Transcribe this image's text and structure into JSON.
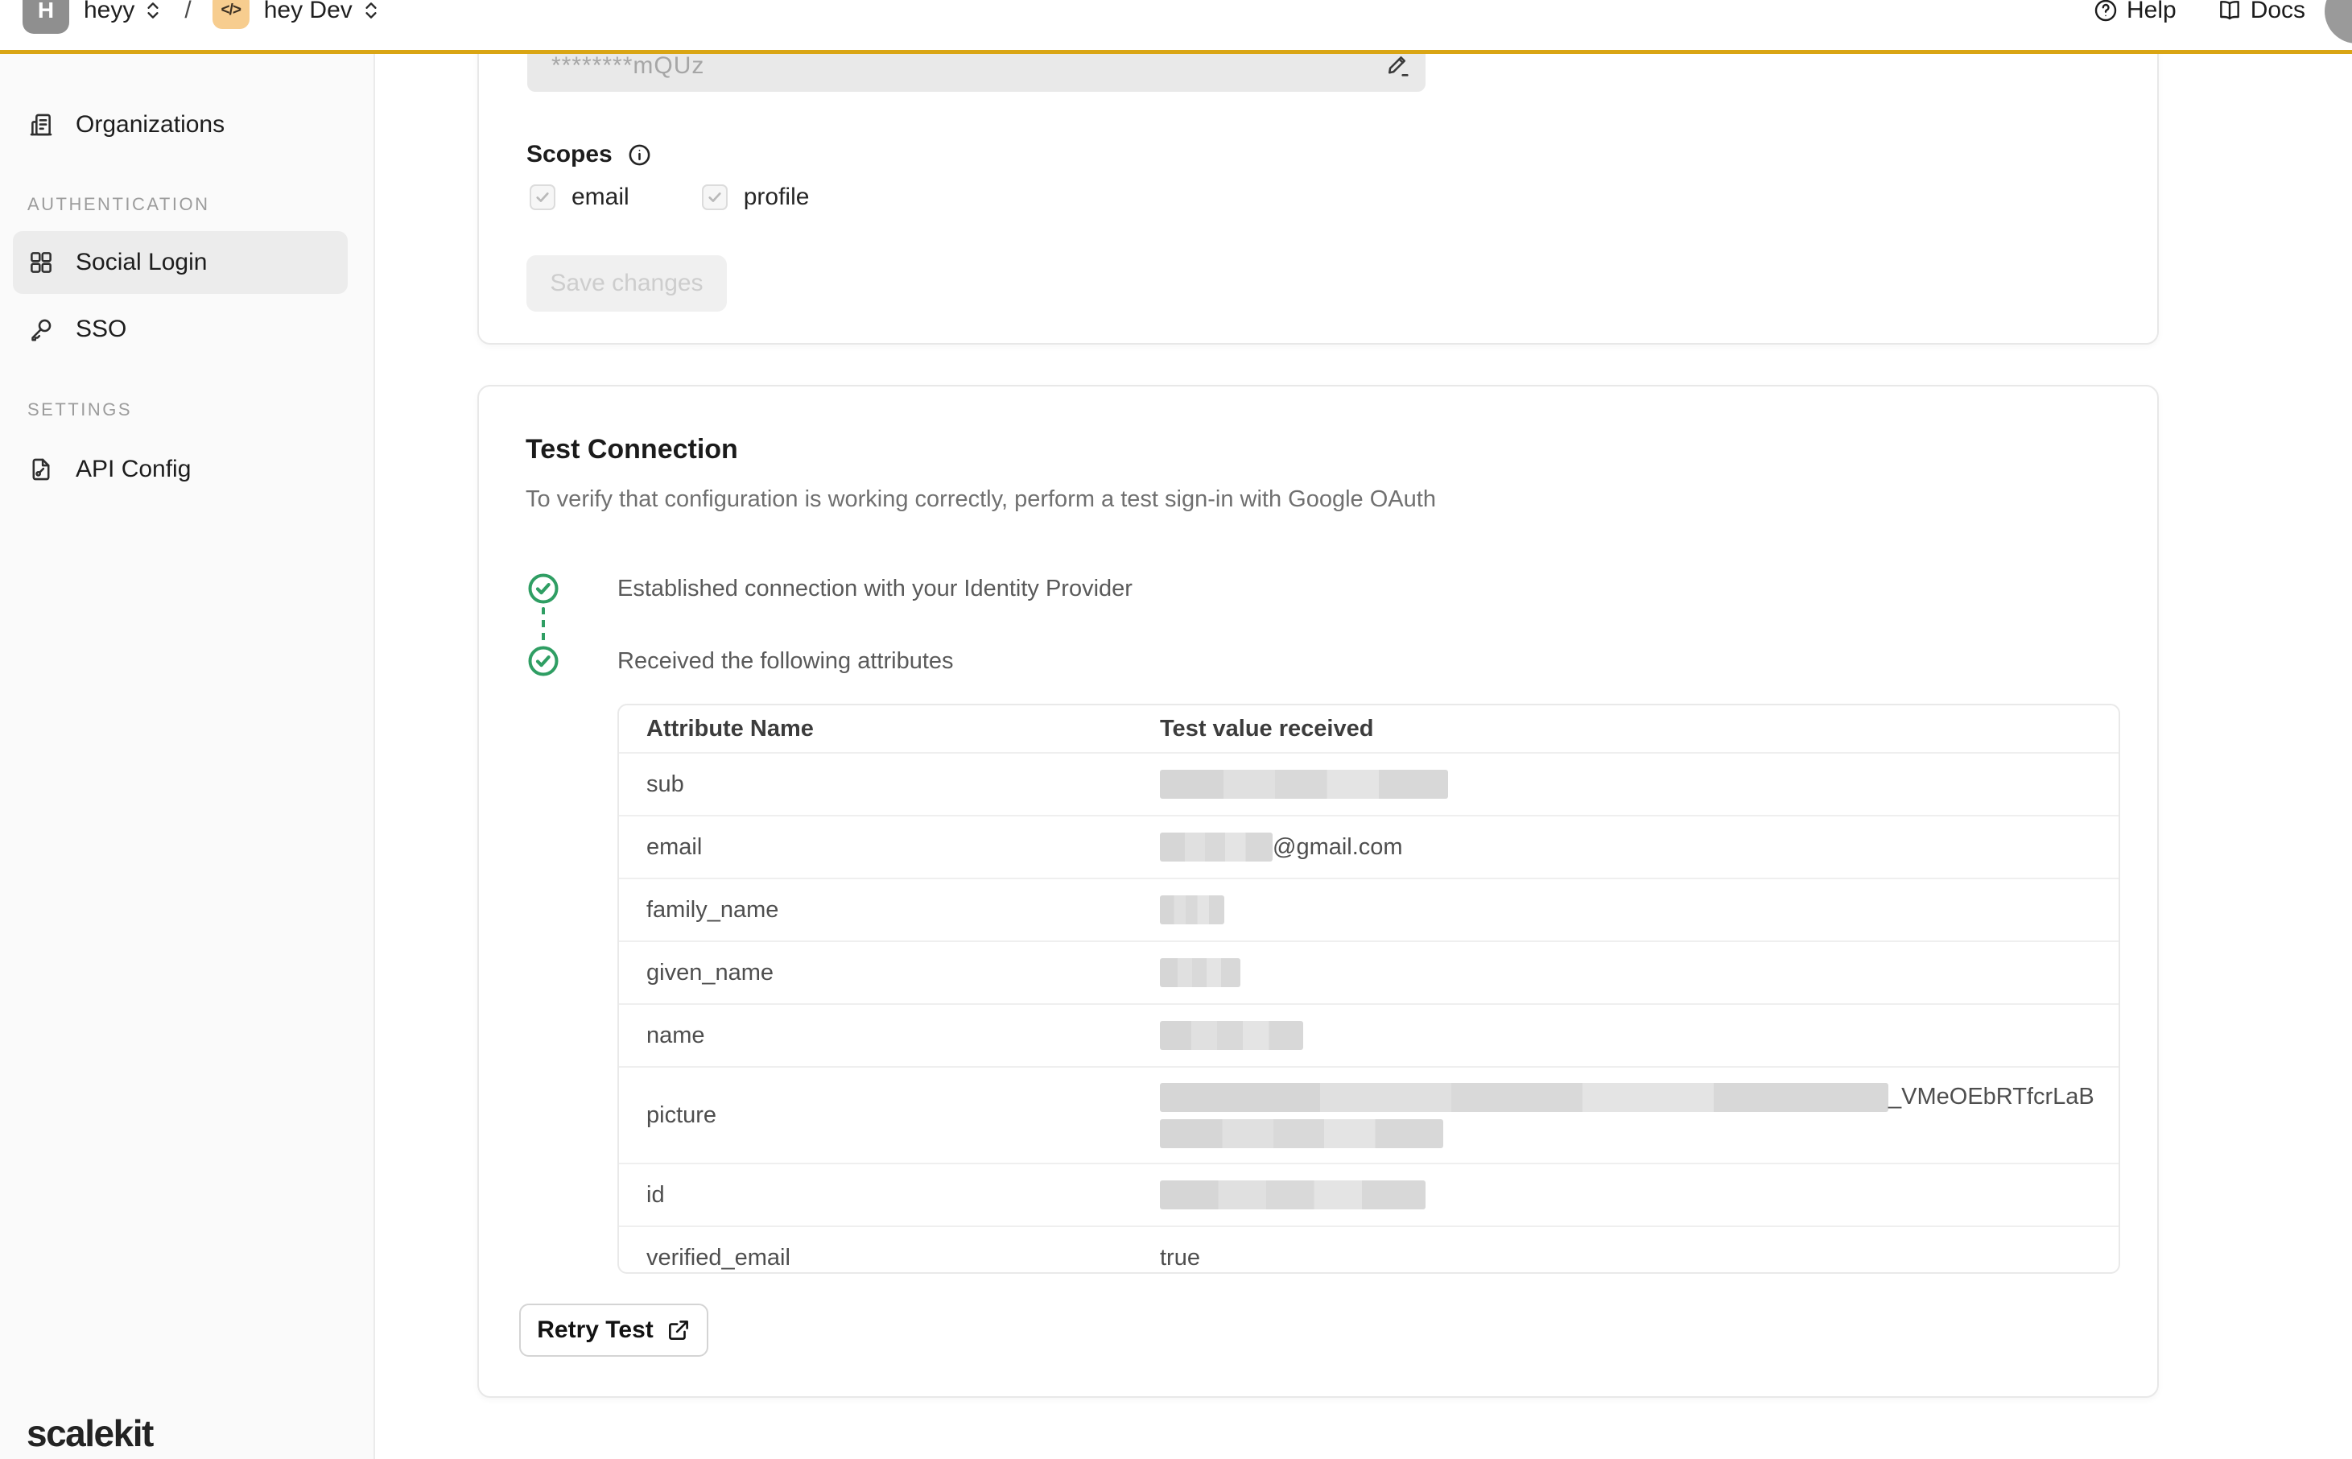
{
  "colors": {
    "accent_gold": "#D9A514",
    "success_green": "#2F9E63",
    "redaction_gray": "#d9d9d9",
    "sidebar_bg": "#fafafa",
    "active_item_bg": "#ececec",
    "project_icon_bg": "#F7CD8F",
    "disabled_button_bg": "#f0f0f0"
  },
  "topbar": {
    "org_initial": "H",
    "org_name": "heyy",
    "separator": "/",
    "project_glyph": "</>",
    "project_name": "hey Dev",
    "help_label": "Help",
    "docs_label": "Docs"
  },
  "sidebar": {
    "sections": [
      {
        "label": "",
        "items": [
          {
            "label": "Organizations",
            "icon": "building-icon",
            "active": false
          }
        ]
      },
      {
        "label": "AUTHENTICATION",
        "items": [
          {
            "label": "Social Login",
            "icon": "grid-icon",
            "active": true
          },
          {
            "label": "SSO",
            "icon": "key-icon",
            "active": false
          }
        ]
      },
      {
        "label": "SETTINGS",
        "items": [
          {
            "label": "API Config",
            "icon": "file-config-icon",
            "active": false
          }
        ]
      }
    ],
    "logo": "scalekit"
  },
  "config_card": {
    "secret_value": "********mQUz",
    "scopes_label": "Scopes",
    "scopes": [
      {
        "label": "email",
        "checked": true,
        "disabled": true
      },
      {
        "label": "profile",
        "checked": true,
        "disabled": true
      }
    ],
    "save_label": "Save changes"
  },
  "test_card": {
    "title": "Test Connection",
    "description": "To verify that configuration is working correctly, perform a test sign-in with Google OAuth",
    "steps": [
      "Established connection with your Identity Provider",
      "Received the following attributes"
    ],
    "table": {
      "headers": [
        "Attribute Name",
        "Test value received"
      ],
      "rows": [
        {
          "name": "sub",
          "value": {
            "lines": [
              {
                "bar": 358
              }
            ]
          }
        },
        {
          "name": "email",
          "value": {
            "lines": [
              {
                "bar": 140,
                "text": "@gmail.com"
              }
            ]
          }
        },
        {
          "name": "family_name",
          "value": {
            "lines": [
              {
                "bar": 80
              }
            ]
          }
        },
        {
          "name": "given_name",
          "value": {
            "lines": [
              {
                "bar": 100
              }
            ]
          }
        },
        {
          "name": "name",
          "value": {
            "lines": [
              {
                "bar": 178
              }
            ]
          }
        },
        {
          "name": "picture",
          "tall": true,
          "value": {
            "lines": [
              {
                "bar": 905,
                "text": "_VMeOEbRTfcrLaB"
              },
              {
                "bar": 352
              }
            ]
          }
        },
        {
          "name": "id",
          "value": {
            "lines": [
              {
                "bar": 330
              }
            ]
          }
        },
        {
          "name": "verified_email",
          "value": {
            "lines": [
              {
                "text": "true"
              }
            ]
          }
        }
      ]
    },
    "retry_label": "Retry Test"
  }
}
